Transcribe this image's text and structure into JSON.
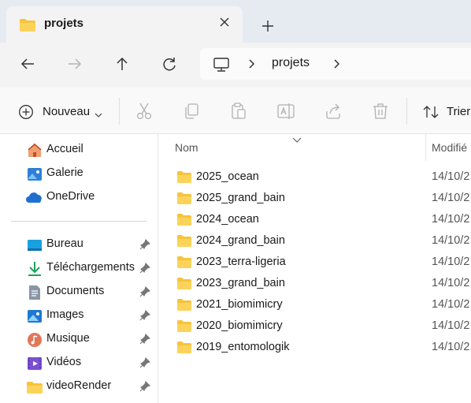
{
  "tab": {
    "title": "projets",
    "new_tab_symbol": "+"
  },
  "address": {
    "crumbs": [
      "projets"
    ]
  },
  "commands": {
    "new_label": "Nouveau",
    "sort_label": "Trier",
    "icons": [
      "cut-icon",
      "copy-icon",
      "paste-icon",
      "rename-icon",
      "share-icon",
      "delete-icon"
    ]
  },
  "sidebar": {
    "items": [
      {
        "label": "Accueil",
        "icon": "home-icon"
      },
      {
        "label": "Galerie",
        "icon": "gallery-icon"
      },
      {
        "label": "OneDrive",
        "icon": "onedrive-icon"
      }
    ],
    "pinned": [
      {
        "label": "Bureau",
        "icon": "desktop-icon"
      },
      {
        "label": "Téléchargements",
        "icon": "download-icon"
      },
      {
        "label": "Documents",
        "icon": "documents-icon"
      },
      {
        "label": "Images",
        "icon": "images-icon"
      },
      {
        "label": "Musique",
        "icon": "music-icon"
      },
      {
        "label": "Vidéos",
        "icon": "videos-icon"
      },
      {
        "label": "videoRender",
        "icon": "folder-icon"
      }
    ]
  },
  "list": {
    "columns": {
      "name": "Nom",
      "modified": "Modifié"
    },
    "rows": [
      {
        "name": "2025_ocean",
        "date": "14/10/2"
      },
      {
        "name": "2025_grand_bain",
        "date": "14/10/2"
      },
      {
        "name": "2024_ocean",
        "date": "14/10/2"
      },
      {
        "name": "2024_grand_bain",
        "date": "14/10/2"
      },
      {
        "name": "2023_terra-ligeria",
        "date": "14/10/2"
      },
      {
        "name": "2023_grand_bain",
        "date": "14/10/2"
      },
      {
        "name": "2021_biomimicry",
        "date": "14/10/2"
      },
      {
        "name": "2020_biomimicry",
        "date": "14/10/2"
      },
      {
        "name": "2019_entomologik",
        "date": "14/10/2"
      }
    ]
  },
  "colors": {
    "folder": "#f8c33a",
    "accent": "#0a64c8",
    "tabstrip": "#e6ebf2"
  }
}
